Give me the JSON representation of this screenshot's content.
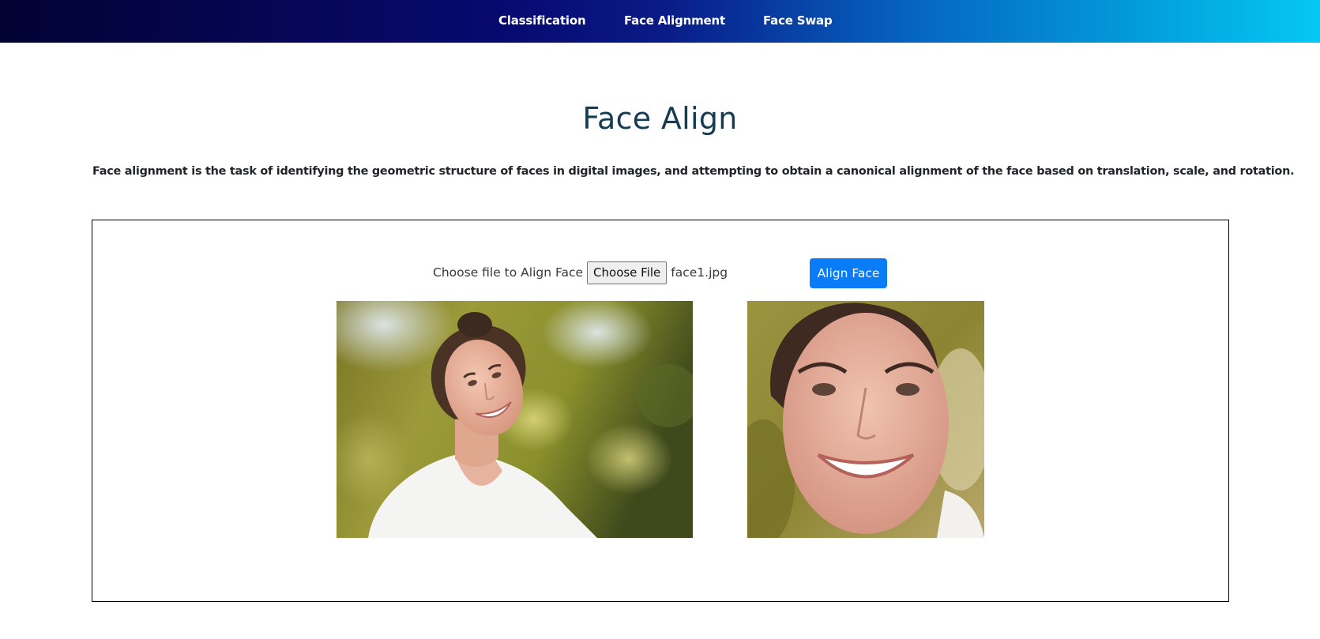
{
  "nav": {
    "items": [
      {
        "label": "Classification"
      },
      {
        "label": "Face Alignment"
      },
      {
        "label": "Face Swap"
      }
    ]
  },
  "page": {
    "title": "Face Align",
    "description": "Face alignment is the task of identifying the geometric structure of faces in digital images, and attempting to obtain a canonical alignment of the face based on translation, scale, and rotation."
  },
  "upload": {
    "label": "Choose file to Align Face",
    "button_label": "Choose File",
    "file_name": "face1.jpg"
  },
  "actions": {
    "align_label": "Align Face"
  },
  "colors": {
    "nav_gradient_start": "#020233",
    "nav_gradient_end": "#04c8f4",
    "title": "#153c53",
    "accent_button": "#0a7cf8"
  }
}
